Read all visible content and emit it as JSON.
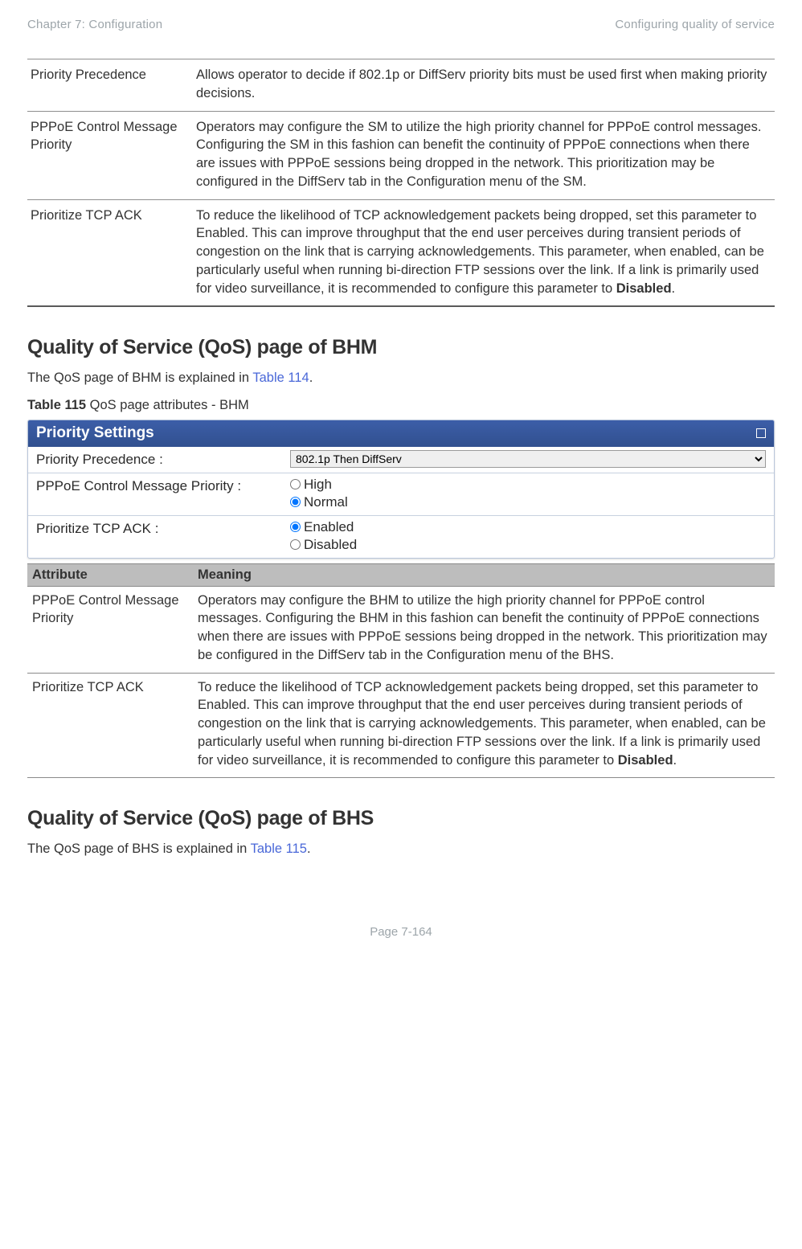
{
  "header": {
    "left": "Chapter 7:  Configuration",
    "right": "Configuring quality of service"
  },
  "topTable": [
    {
      "attr": "Priority Precedence",
      "meaning": "Allows operator to decide if 802.1p or DiffServ priority bits must be used first when making priority decisions."
    },
    {
      "attr": "PPPoE Control Message Priority",
      "meaning": "Operators may configure the SM to utilize the high priority channel for PPPoE control messages. Configuring the SM in this fashion can benefit the continuity of PPPoE connections when there are issues with PPPoE sessions being dropped in the network. This prioritization may be configured in the DiffServ tab in the Configuration menu of the SM."
    },
    {
      "attr": "Prioritize TCP ACK",
      "meaning_pre": "To reduce the likelihood of TCP acknowledgement packets being dropped, set this parameter to Enabled. This can improve throughput that the end user perceives during transient periods of congestion on the link that is carrying acknowledgements. This parameter, when enabled, can be particularly useful when running bi-direction FTP sessions over the link. If a link is primarily used for video surveillance, it is recommended to configure this parameter to ",
      "meaning_bold": "Disabled",
      "meaning_post": "."
    }
  ],
  "section1": {
    "title": "Quality of Service (QoS) page of BHM",
    "intro_pre": "The QoS page of BHM is explained in ",
    "intro_link": "Table 114",
    "intro_post": "."
  },
  "caption": {
    "bold": "Table 115",
    "rest": " QoS page attributes - BHM"
  },
  "panel": {
    "title": "Priority Settings",
    "rows": {
      "pp": {
        "label": "Priority Precedence :",
        "select": "802.1p Then DiffServ"
      },
      "pppoe": {
        "label": "PPPoE Control Message Priority :",
        "opt_high": "High",
        "opt_normal": "Normal"
      },
      "tcp": {
        "label": "Prioritize TCP ACK :",
        "opt_enabled": "Enabled",
        "opt_disabled": "Disabled"
      }
    }
  },
  "attrTable": {
    "head": {
      "attr": "Attribute",
      "meaning": "Meaning"
    },
    "rows": [
      {
        "attr": "PPPoE Control Message Priority",
        "meaning": "Operators may configure the BHM to utilize the high priority channel for PPPoE control messages. Configuring the BHM in this fashion can benefit the continuity of PPPoE connections when there are issues with PPPoE sessions being dropped in the network. This prioritization may be configured in the DiffServ tab in the Configuration menu of the BHS."
      },
      {
        "attr": "Prioritize TCP ACK",
        "meaning_pre": "To reduce the likelihood of TCP acknowledgement packets being dropped, set this parameter to Enabled. This can improve throughput that the end user perceives during transient periods of congestion on the link that is carrying acknowledgements. This parameter, when enabled, can be particularly useful when running bi-direction FTP sessions over the link. If a link is primarily used for video surveillance, it is recommended to configure this parameter to ",
        "meaning_bold": "Disabled",
        "meaning_post": "."
      }
    ]
  },
  "section2": {
    "title": "Quality of Service (QoS) page of BHS",
    "intro_pre": "The QoS page of BHS is explained in ",
    "intro_link": "Table 115",
    "intro_post": "."
  },
  "footer": "Page 7-164",
  "chart_data": {
    "type": "table",
    "title": "QoS page attributes - BHM",
    "columns": [
      "Attribute",
      "Meaning"
    ],
    "rows": [
      [
        "PPPoE Control Message Priority",
        "Operators may configure the BHM to utilize the high priority channel for PPPoE control messages. Configuring the BHM in this fashion can benefit the continuity of PPPoE connections when there are issues with PPPoE sessions being dropped in the network. This prioritization may be configured in the DiffServ tab in the Configuration menu of the BHS."
      ],
      [
        "Prioritize TCP ACK",
        "To reduce the likelihood of TCP acknowledgement packets being dropped, set this parameter to Enabled. This can improve throughput that the end user perceives during transient periods of congestion on the link that is carrying acknowledgements. This parameter, when enabled, can be particularly useful when running bi-direction FTP sessions over the link. If a link is primarily used for video surveillance, it is recommended to configure this parameter to Disabled."
      ]
    ]
  }
}
